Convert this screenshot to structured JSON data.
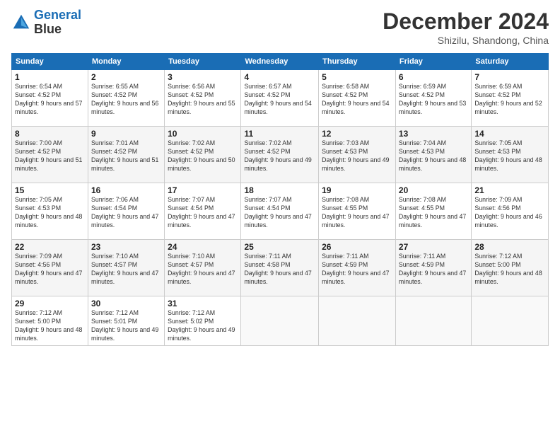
{
  "header": {
    "logo_line1": "General",
    "logo_line2": "Blue",
    "month": "December 2024",
    "location": "Shizilu, Shandong, China"
  },
  "weekdays": [
    "Sunday",
    "Monday",
    "Tuesday",
    "Wednesday",
    "Thursday",
    "Friday",
    "Saturday"
  ],
  "weeks": [
    [
      {
        "day": "1",
        "sunrise": "6:54 AM",
        "sunset": "4:52 PM",
        "daylight": "9 hours and 57 minutes."
      },
      {
        "day": "2",
        "sunrise": "6:55 AM",
        "sunset": "4:52 PM",
        "daylight": "9 hours and 56 minutes."
      },
      {
        "day": "3",
        "sunrise": "6:56 AM",
        "sunset": "4:52 PM",
        "daylight": "9 hours and 55 minutes."
      },
      {
        "day": "4",
        "sunrise": "6:57 AM",
        "sunset": "4:52 PM",
        "daylight": "9 hours and 54 minutes."
      },
      {
        "day": "5",
        "sunrise": "6:58 AM",
        "sunset": "4:52 PM",
        "daylight": "9 hours and 54 minutes."
      },
      {
        "day": "6",
        "sunrise": "6:59 AM",
        "sunset": "4:52 PM",
        "daylight": "9 hours and 53 minutes."
      },
      {
        "day": "7",
        "sunrise": "6:59 AM",
        "sunset": "4:52 PM",
        "daylight": "9 hours and 52 minutes."
      }
    ],
    [
      {
        "day": "8",
        "sunrise": "7:00 AM",
        "sunset": "4:52 PM",
        "daylight": "9 hours and 51 minutes."
      },
      {
        "day": "9",
        "sunrise": "7:01 AM",
        "sunset": "4:52 PM",
        "daylight": "9 hours and 51 minutes."
      },
      {
        "day": "10",
        "sunrise": "7:02 AM",
        "sunset": "4:52 PM",
        "daylight": "9 hours and 50 minutes."
      },
      {
        "day": "11",
        "sunrise": "7:02 AM",
        "sunset": "4:52 PM",
        "daylight": "9 hours and 49 minutes."
      },
      {
        "day": "12",
        "sunrise": "7:03 AM",
        "sunset": "4:53 PM",
        "daylight": "9 hours and 49 minutes."
      },
      {
        "day": "13",
        "sunrise": "7:04 AM",
        "sunset": "4:53 PM",
        "daylight": "9 hours and 48 minutes."
      },
      {
        "day": "14",
        "sunrise": "7:05 AM",
        "sunset": "4:53 PM",
        "daylight": "9 hours and 48 minutes."
      }
    ],
    [
      {
        "day": "15",
        "sunrise": "7:05 AM",
        "sunset": "4:53 PM",
        "daylight": "9 hours and 48 minutes."
      },
      {
        "day": "16",
        "sunrise": "7:06 AM",
        "sunset": "4:54 PM",
        "daylight": "9 hours and 47 minutes."
      },
      {
        "day": "17",
        "sunrise": "7:07 AM",
        "sunset": "4:54 PM",
        "daylight": "9 hours and 47 minutes."
      },
      {
        "day": "18",
        "sunrise": "7:07 AM",
        "sunset": "4:54 PM",
        "daylight": "9 hours and 47 minutes."
      },
      {
        "day": "19",
        "sunrise": "7:08 AM",
        "sunset": "4:55 PM",
        "daylight": "9 hours and 47 minutes."
      },
      {
        "day": "20",
        "sunrise": "7:08 AM",
        "sunset": "4:55 PM",
        "daylight": "9 hours and 47 minutes."
      },
      {
        "day": "21",
        "sunrise": "7:09 AM",
        "sunset": "4:56 PM",
        "daylight": "9 hours and 46 minutes."
      }
    ],
    [
      {
        "day": "22",
        "sunrise": "7:09 AM",
        "sunset": "4:56 PM",
        "daylight": "9 hours and 47 minutes."
      },
      {
        "day": "23",
        "sunrise": "7:10 AM",
        "sunset": "4:57 PM",
        "daylight": "9 hours and 47 minutes."
      },
      {
        "day": "24",
        "sunrise": "7:10 AM",
        "sunset": "4:57 PM",
        "daylight": "9 hours and 47 minutes."
      },
      {
        "day": "25",
        "sunrise": "7:11 AM",
        "sunset": "4:58 PM",
        "daylight": "9 hours and 47 minutes."
      },
      {
        "day": "26",
        "sunrise": "7:11 AM",
        "sunset": "4:59 PM",
        "daylight": "9 hours and 47 minutes."
      },
      {
        "day": "27",
        "sunrise": "7:11 AM",
        "sunset": "4:59 PM",
        "daylight": "9 hours and 47 minutes."
      },
      {
        "day": "28",
        "sunrise": "7:12 AM",
        "sunset": "5:00 PM",
        "daylight": "9 hours and 48 minutes."
      }
    ],
    [
      {
        "day": "29",
        "sunrise": "7:12 AM",
        "sunset": "5:00 PM",
        "daylight": "9 hours and 48 minutes."
      },
      {
        "day": "30",
        "sunrise": "7:12 AM",
        "sunset": "5:01 PM",
        "daylight": "9 hours and 49 minutes."
      },
      {
        "day": "31",
        "sunrise": "7:12 AM",
        "sunset": "5:02 PM",
        "daylight": "9 hours and 49 minutes."
      },
      null,
      null,
      null,
      null
    ]
  ]
}
